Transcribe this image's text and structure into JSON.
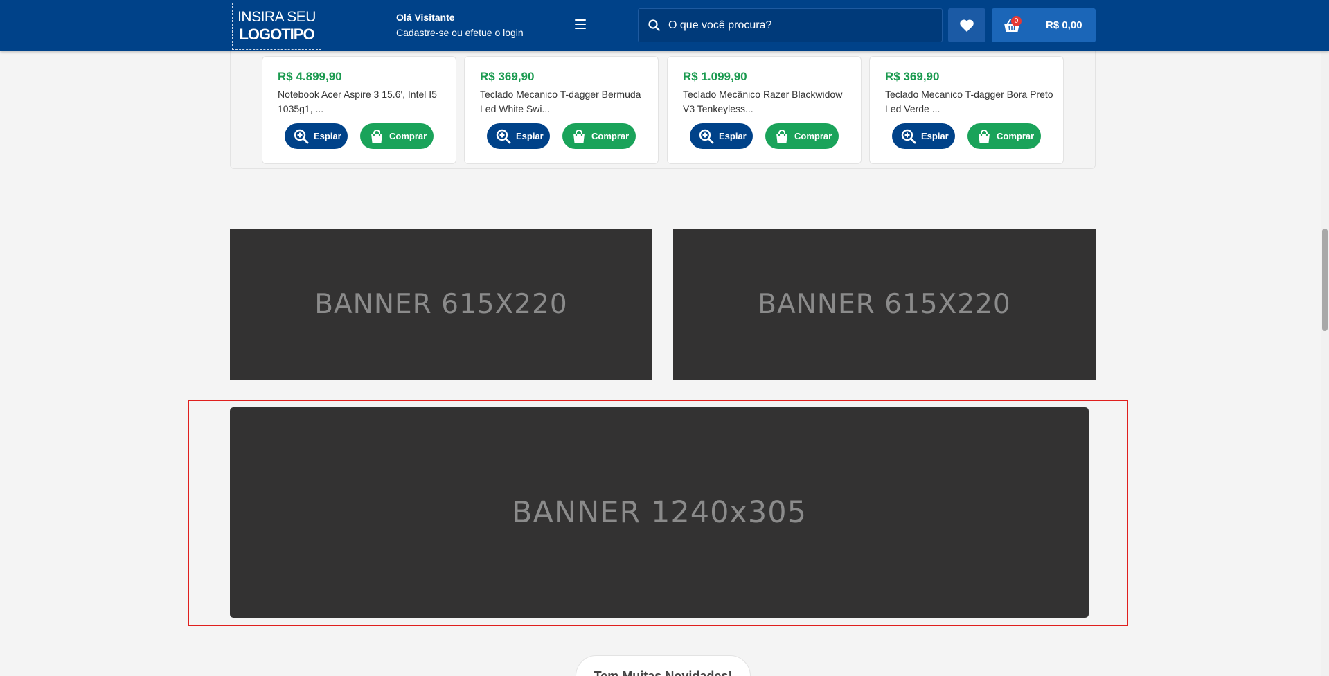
{
  "header": {
    "logo_line1": "INSIRA SEU",
    "logo_line2": "LOGOTIPO",
    "greeting": "Olá Visitante",
    "register_link": "Cadastre-se",
    "or_text": " ou ",
    "login_link": "efetue o login",
    "search_placeholder": "O que você procura?",
    "cart_count": "0",
    "cart_total": "R$ 0,00"
  },
  "products": [
    {
      "price": "R$ 4.899,90",
      "name": "Notebook Acer Aspire 3 15.6', Intel I5 1035g1, ...",
      "spy_label": "Espiar",
      "buy_label": "Comprar"
    },
    {
      "price": "R$ 369,90",
      "name": "Teclado Mecanico T-dagger Bermuda Led White Swi...",
      "spy_label": "Espiar",
      "buy_label": "Comprar"
    },
    {
      "price": "R$ 1.099,90",
      "name": "Teclado Mecânico Razer Blackwidow V3 Tenkeyless...",
      "spy_label": "Espiar",
      "buy_label": "Comprar"
    },
    {
      "price": "R$ 369,90",
      "name": "Teclado Mecanico T-dagger Bora Preto Led Verde ...",
      "spy_label": "Espiar",
      "buy_label": "Comprar"
    }
  ],
  "banners": {
    "left": "BANNER 615X220",
    "right": "BANNER 615X220",
    "wide": "BANNER 1240x305"
  },
  "news_tab": "Tem Muitas Novidades!",
  "colors": {
    "header_bg": "#004289",
    "price_green": "#1a9a4f",
    "buy_green": "#1aa35a",
    "spy_blue": "#004289",
    "highlight_red": "#e0201e",
    "banner_bg": "#333232"
  }
}
